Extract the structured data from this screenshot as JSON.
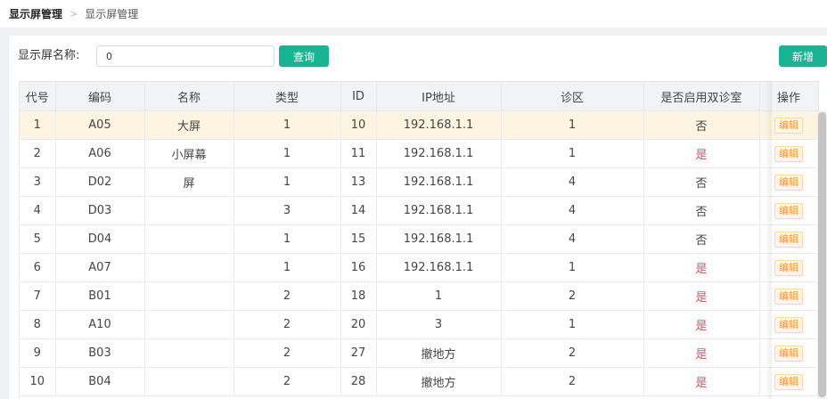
{
  "breadcrumb": {
    "first": "显示屏管理",
    "separator": ">",
    "second": "显示屏管理"
  },
  "search": {
    "label": "显示屏名称:",
    "value": "0",
    "query_label": "查询"
  },
  "toolbar": {
    "add_label": "新增"
  },
  "table": {
    "headers": [
      "代号",
      "编码",
      "名称",
      "类型",
      "ID",
      "IP地址",
      "诊区",
      "是否启用双诊室",
      "操作"
    ],
    "rows": [
      {
        "code": "1",
        "encode": "A05",
        "name": "大屏",
        "type": "1",
        "id": "10",
        "ip": "192.168.1.1",
        "zone": "1",
        "dual": "否",
        "action": "编辑"
      },
      {
        "code": "2",
        "encode": "A06",
        "name": "小屏幕",
        "type": "1",
        "id": "11",
        "ip": "192.168.1.1",
        "zone": "1",
        "dual": "是",
        "action": "编辑"
      },
      {
        "code": "3",
        "encode": "D02",
        "name": "屏",
        "type": "1",
        "id": "13",
        "ip": "192.168.1.1",
        "zone": "4",
        "dual": "否",
        "action": "编辑"
      },
      {
        "code": "4",
        "encode": "D03",
        "name": "",
        "type": "3",
        "id": "14",
        "ip": "192.168.1.1",
        "zone": "4",
        "dual": "否",
        "action": "编辑"
      },
      {
        "code": "5",
        "encode": "D04",
        "name": "",
        "type": "1",
        "id": "15",
        "ip": "192.168.1.1",
        "zone": "4",
        "dual": "否",
        "action": "编辑"
      },
      {
        "code": "6",
        "encode": "A07",
        "name": "",
        "type": "1",
        "id": "16",
        "ip": "192.168.1.1",
        "zone": "1",
        "dual": "是",
        "action": "编辑"
      },
      {
        "code": "7",
        "encode": "B01",
        "name": "",
        "type": "2",
        "id": "18",
        "ip": "1",
        "zone": "2",
        "dual": "是",
        "action": "编辑"
      },
      {
        "code": "8",
        "encode": "A10",
        "name": "",
        "type": "2",
        "id": "20",
        "ip": "3",
        "zone": "1",
        "dual": "是",
        "action": "编辑"
      },
      {
        "code": "9",
        "encode": "B03",
        "name": "",
        "type": "2",
        "id": "27",
        "ip": "撤地方",
        "zone": "2",
        "dual": "是",
        "action": "编辑"
      },
      {
        "code": "10",
        "encode": "B04",
        "name": "",
        "type": "2",
        "id": "28",
        "ip": "撤地方",
        "zone": "2",
        "dual": "是",
        "action": "编辑"
      }
    ]
  },
  "colors": {
    "accent": "#1ab394",
    "yes": "#e0514f",
    "edit": "#e8963a",
    "highlight_row": "#fdf4e1"
  }
}
